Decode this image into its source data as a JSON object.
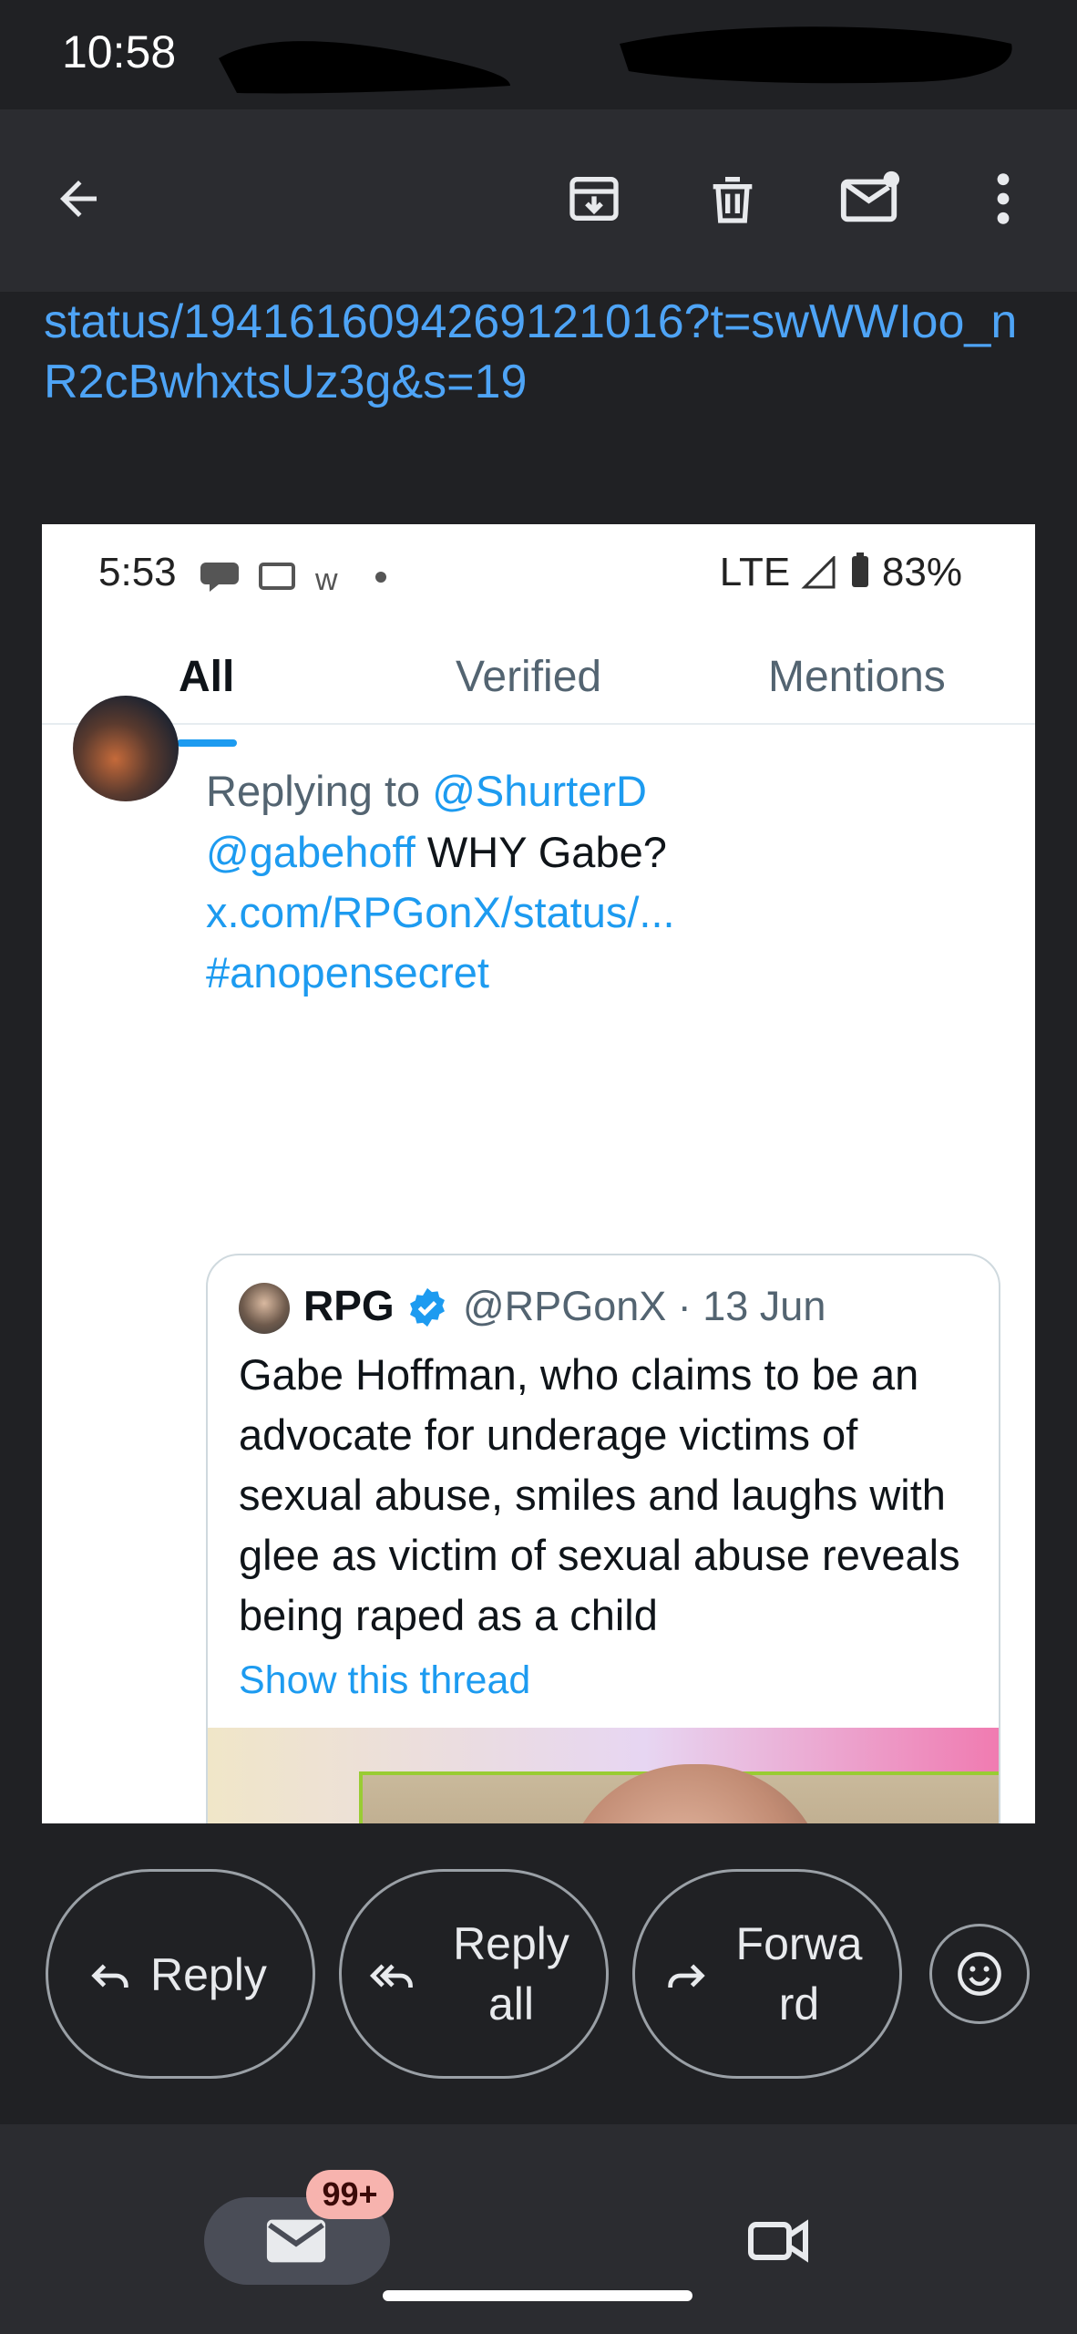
{
  "status_bar": {
    "time": "10:58"
  },
  "app_bar": {
    "back_icon": "arrow-left-icon",
    "actions": [
      "archive-icon",
      "delete-icon",
      "mark-unread-icon",
      "more-vert-icon"
    ]
  },
  "email": {
    "link_text": "status/1941616094269121016?t=swWWIoo_nR2cBwhxtsUz3g&s=19",
    "screenshot": {
      "status": {
        "time": "5:53",
        "network": "LTE",
        "battery": "83%"
      },
      "tabs": [
        {
          "label": "All",
          "active": true
        },
        {
          "label": "Verified",
          "active": false
        },
        {
          "label": "Mentions",
          "active": false
        }
      ],
      "reply": {
        "replying_prefix": "Replying to ",
        "replying_to": "@ShurterD",
        "mention": "@gabehoff",
        "text": " WHY Gabe?",
        "link": "x.com/RPGonX/status/...",
        "hashtag": "#anopensecret"
      },
      "quote": {
        "name": "RPG",
        "handle": "@RPGonX · 13 Jun",
        "text": "Gabe Hoffman, who claims to be an advocate for underage victims of sexual abuse, smiles and laughs with glee as victim of sexual abuse reveals being raped as a child",
        "show_thread": "Show this thread"
      }
    }
  },
  "actions": {
    "reply": "Reply",
    "reply_all": "Reply all",
    "forward": "Forward"
  },
  "bottom_nav": {
    "mail_badge": "99+"
  },
  "colors": {
    "link": "#4ea4f6",
    "twitter_blue": "#1d9bf0",
    "badge": "#f7b3ae"
  }
}
